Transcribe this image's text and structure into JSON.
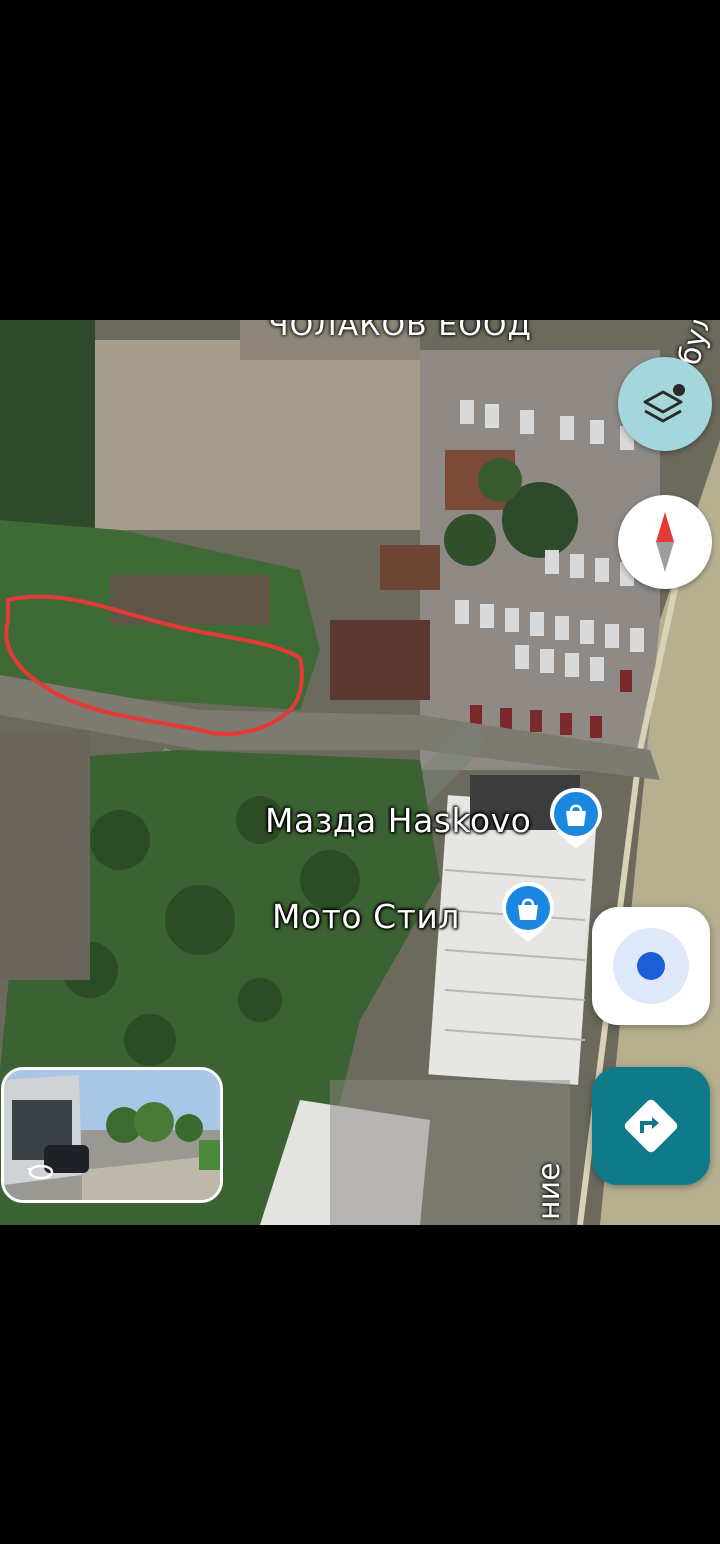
{
  "map": {
    "top_partial_label": "ЧОЛАКОВ ЕООД",
    "street_right_label": "бул. Васил Левски",
    "street_bottom_label": "ние",
    "pois": [
      {
        "name": "Мазда Haskovo",
        "icon": "shopping-bag-icon"
      },
      {
        "name": "Мото Стил",
        "icon": "shopping-bag-icon"
      }
    ],
    "highlight_color": "#e53935",
    "controls": {
      "layers": "layers-icon",
      "compass": "compass-icon",
      "my_location": "my-location-icon",
      "directions": "directions-icon"
    },
    "street_view_preview": "street-view-thumbnail",
    "accent_colors": {
      "pin": "#1a88e0",
      "directions": "#0e7a8a",
      "layers_bg": "#a5d6dc",
      "location_dot": "#1a5fd8"
    }
  }
}
